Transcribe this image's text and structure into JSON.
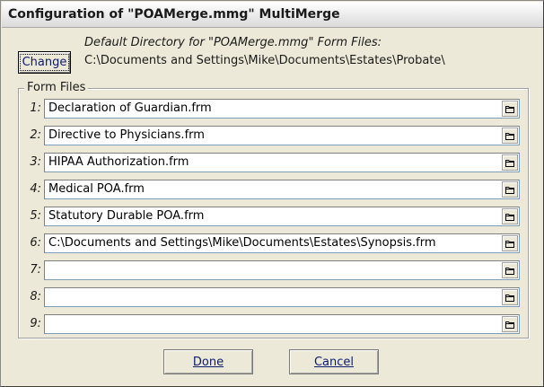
{
  "window": {
    "title": "Configuration of \"POAMerge.mmg\" MultiMerge"
  },
  "directory": {
    "change_label": "Change",
    "label": "Default Directory for \"POAMerge.mmg\" Form Files:",
    "path": "C:\\Documents and Settings\\Mike\\Documents\\Estates\\Probate\\"
  },
  "form_files": {
    "legend": "Form Files",
    "browse_icon": "folder-icon",
    "rows": [
      {
        "num": "1:",
        "value": "Declaration of Guardian.frm"
      },
      {
        "num": "2:",
        "value": "Directive to Physicians.frm"
      },
      {
        "num": "3:",
        "value": "HIPAA Authorization.frm"
      },
      {
        "num": "4:",
        "value": "Medical POA.frm"
      },
      {
        "num": "5:",
        "value": "Statutory Durable POA.frm"
      },
      {
        "num": "6:",
        "value": "C:\\Documents and Settings\\Mike\\Documents\\Estates\\Synopsis.frm"
      },
      {
        "num": "7:",
        "value": ""
      },
      {
        "num": "8:",
        "value": ""
      },
      {
        "num": "9:",
        "value": ""
      }
    ]
  },
  "buttons": {
    "done_label": "Done",
    "cancel_label": "Cancel"
  }
}
